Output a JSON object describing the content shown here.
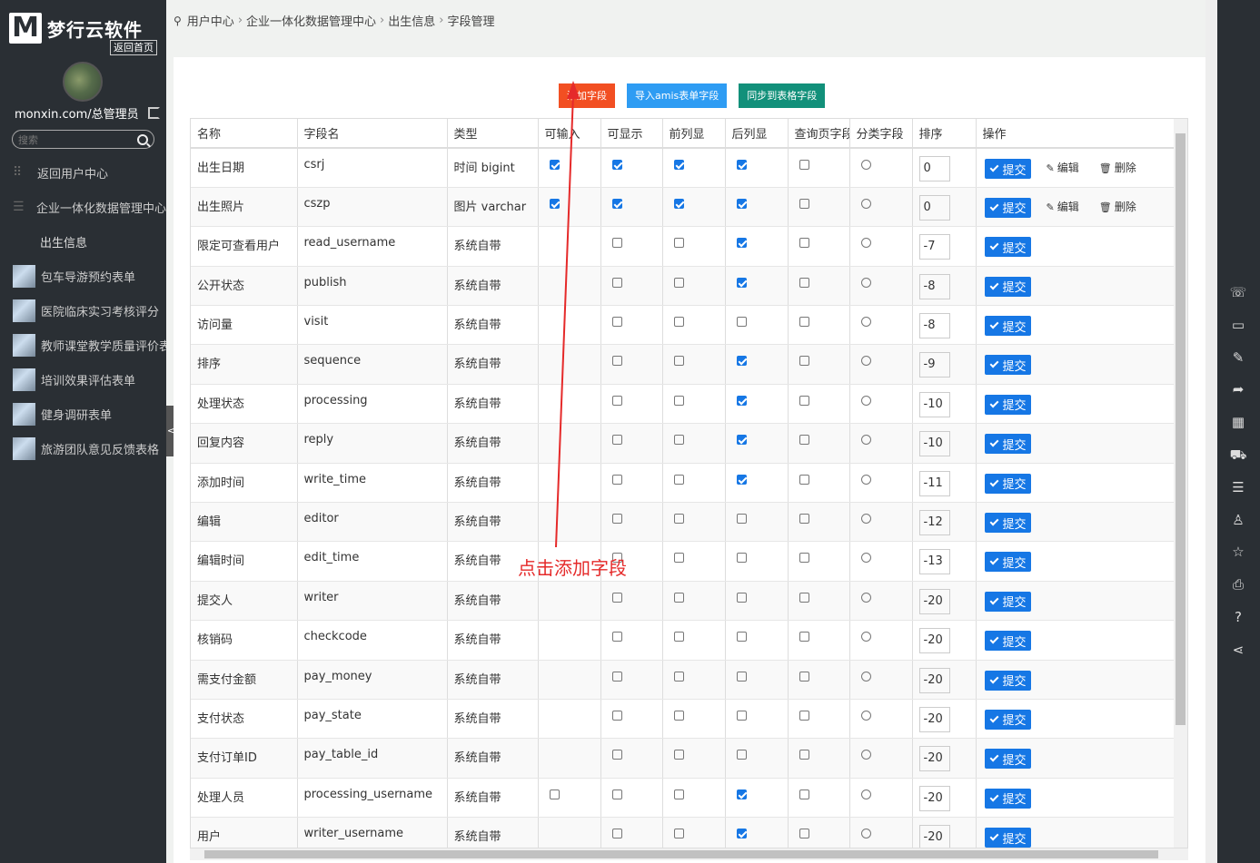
{
  "sidebar": {
    "logo_mark": "M",
    "logo_text": "梦行云软件",
    "home_link": "返回首页",
    "user": "monxin.com/总管理员",
    "search_placeholder": "搜索",
    "nav": [
      {
        "label": "返回用户中心",
        "icon": "grid-icon"
      },
      {
        "label": "企业一体化数据管理中心",
        "icon": "list-icon"
      },
      {
        "label": "出生信息"
      },
      {
        "label": "包车导游预约表单"
      },
      {
        "label": "医院临床实习考核评分"
      },
      {
        "label": "教师课堂教学质量评价表"
      },
      {
        "label": "培训效果评估表单"
      },
      {
        "label": "健身调研表单"
      },
      {
        "label": "旅游团队意见反馈表格"
      }
    ],
    "collapse": "<"
  },
  "breadcrumb": [
    "用户中心",
    "企业一体化数据管理中心",
    "出生信息",
    "字段管理"
  ],
  "buttons": {
    "add": "添加字段",
    "import": "导入amis表单字段",
    "sync": "同步到表格字段"
  },
  "table": {
    "headers": [
      "名称",
      "字段名",
      "类型",
      "可输入",
      "可显示",
      "前列显",
      "后列显",
      "查询页字段",
      "分类字段",
      "排序",
      "操作"
    ],
    "submit": "提交",
    "edit": "编辑",
    "delete": "删除",
    "rows": [
      {
        "name": "出生日期",
        "field": "csrj",
        "type": "时间 bigint",
        "input": true,
        "show": true,
        "front": true,
        "back": true,
        "query": false,
        "sort": "0",
        "editable": true
      },
      {
        "name": "出生照片",
        "field": "cszp",
        "type": "图片 varchar",
        "input": true,
        "show": true,
        "front": true,
        "back": true,
        "query": false,
        "sort": "0",
        "editable": true
      },
      {
        "name": "限定可查看用户",
        "field": "read_username",
        "type": "系统自带",
        "input": null,
        "show": false,
        "front": false,
        "back": true,
        "query": false,
        "sort": "-7"
      },
      {
        "name": "公开状态",
        "field": "publish",
        "type": "系统自带",
        "input": null,
        "show": false,
        "front": false,
        "back": true,
        "query": false,
        "sort": "-8"
      },
      {
        "name": "访问量",
        "field": "visit",
        "type": "系统自带",
        "input": null,
        "show": false,
        "front": false,
        "back": false,
        "query": false,
        "sort": "-8"
      },
      {
        "name": "排序",
        "field": "sequence",
        "type": "系统自带",
        "input": null,
        "show": false,
        "front": false,
        "back": true,
        "query": false,
        "sort": "-9"
      },
      {
        "name": "处理状态",
        "field": "processing",
        "type": "系统自带",
        "input": null,
        "show": false,
        "front": false,
        "back": true,
        "query": false,
        "sort": "-10"
      },
      {
        "name": "回复内容",
        "field": "reply",
        "type": "系统自带",
        "input": null,
        "show": false,
        "front": false,
        "back": true,
        "query": false,
        "sort": "-10"
      },
      {
        "name": "添加时间",
        "field": "write_time",
        "type": "系统自带",
        "input": null,
        "show": false,
        "front": false,
        "back": true,
        "query": false,
        "sort": "-11"
      },
      {
        "name": "编辑",
        "field": "editor",
        "type": "系统自带",
        "input": null,
        "show": false,
        "front": false,
        "back": false,
        "query": false,
        "sort": "-12"
      },
      {
        "name": "编辑时间",
        "field": "edit_time",
        "type": "系统自带",
        "input": null,
        "show": false,
        "front": false,
        "back": false,
        "query": false,
        "sort": "-13"
      },
      {
        "name": "提交人",
        "field": "writer",
        "type": "系统自带",
        "input": null,
        "show": false,
        "front": false,
        "back": false,
        "query": false,
        "sort": "-20"
      },
      {
        "name": "核销码",
        "field": "checkcode",
        "type": "系统自带",
        "input": null,
        "show": false,
        "front": false,
        "back": false,
        "query": false,
        "sort": "-20"
      },
      {
        "name": "需支付金额",
        "field": "pay_money",
        "type": "系统自带",
        "input": null,
        "show": false,
        "front": false,
        "back": false,
        "query": false,
        "sort": "-20"
      },
      {
        "name": "支付状态",
        "field": "pay_state",
        "type": "系统自带",
        "input": null,
        "show": false,
        "front": false,
        "back": false,
        "query": false,
        "sort": "-20"
      },
      {
        "name": "支付订单ID",
        "field": "pay_table_id",
        "type": "系统自带",
        "input": null,
        "show": false,
        "front": false,
        "back": false,
        "query": false,
        "sort": "-20"
      },
      {
        "name": "处理人员",
        "field": "processing_username",
        "type": "系统自带",
        "input": false,
        "show": false,
        "front": false,
        "back": true,
        "query": false,
        "sort": "-20"
      },
      {
        "name": "用户",
        "field": "writer_username",
        "type": "系统自带",
        "input": null,
        "show": false,
        "front": false,
        "back": true,
        "query": false,
        "sort": "-20"
      }
    ]
  },
  "annotation": "点击添加字段",
  "annotation_color": "#e52a2a",
  "right_icons": [
    "wechat-icon",
    "comment-icon",
    "edit-icon",
    "share-arrow-icon",
    "qrcode-icon",
    "cart-icon",
    "list-icon",
    "user-icon",
    "star-icon",
    "print-icon",
    "help-icon",
    "share-icon"
  ]
}
